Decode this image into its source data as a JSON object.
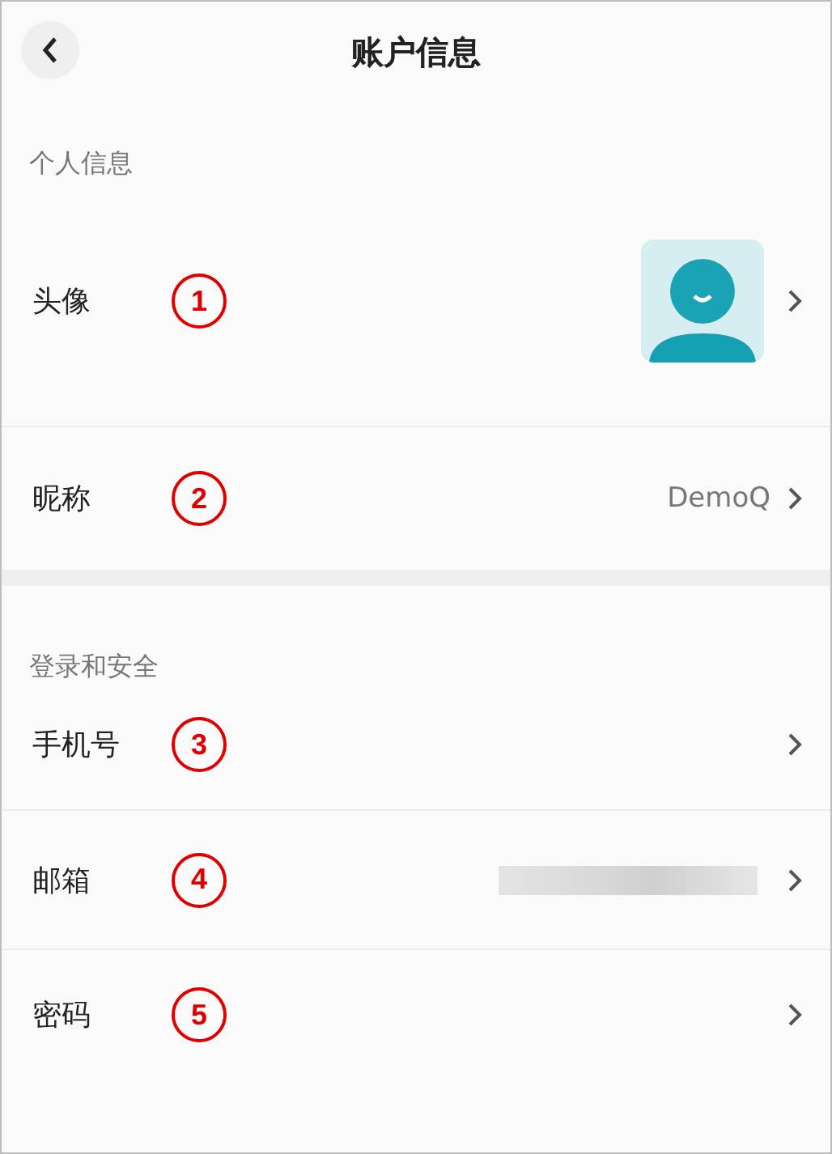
{
  "header": {
    "title": "账户信息"
  },
  "sections": [
    {
      "title": "个人信息",
      "rows": [
        {
          "label": "头像",
          "marker": "1",
          "kind": "avatar"
        },
        {
          "label": "昵称",
          "marker": "2",
          "kind": "text",
          "value": "DemoQ"
        }
      ]
    },
    {
      "title": "登录和安全",
      "rows": [
        {
          "label": "手机号",
          "marker": "3",
          "kind": "plain"
        },
        {
          "label": "邮箱",
          "marker": "4",
          "kind": "redacted"
        },
        {
          "label": "密码",
          "marker": "5",
          "kind": "plain"
        }
      ]
    }
  ]
}
